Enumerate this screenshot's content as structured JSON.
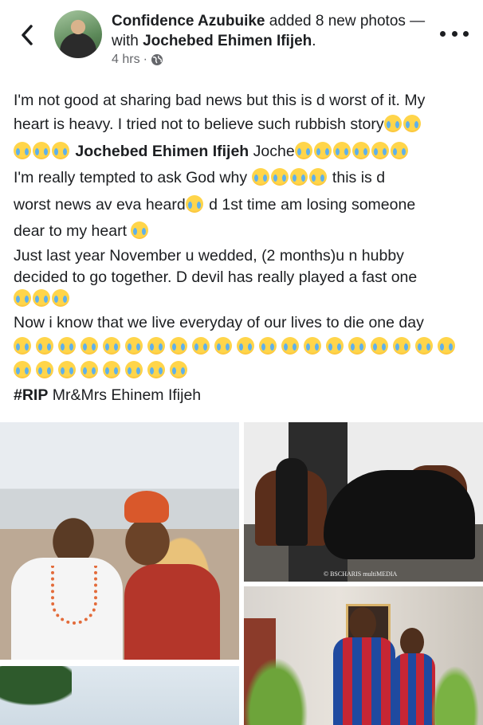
{
  "header": {
    "author": "Confidence Azubuike",
    "action": " added 8 new photos — with ",
    "tagged": "Jochebed Ehimen Ifijeh",
    "period": ".",
    "time": "4 hrs",
    "separator": "·"
  },
  "post": {
    "line1": "I'm not good at sharing bad news but this is d worst of it. My",
    "line2": "heart is heavy. I tried not to believe such rubbish story",
    "line3_mention": "Jochebed Ehimen Ifijeh",
    "line3_rest": " Joche",
    "line4a": "I'm really tempted to ask God why ",
    "line4b": " this is d",
    "line5a": "worst news av eva heard",
    "line5b": " d 1st time am losing someone",
    "line6": "dear to my heart ",
    "line7": "Just last year November u wedded, (2 months)u n hubby",
    "line8": "decided to go together.  D devil has really played a fast one",
    "line10": "Now i know that we live everyday of our lives to die one day",
    "hashtag": "#RIP",
    "line_last": " Mr&Mrs Ehinem Ifijeh"
  },
  "photos": {
    "watermark": "© BSCHARIS multiMEDIA"
  },
  "icons": {
    "back": "chevron-left-icon",
    "globe": "globe-icon",
    "more": "more-horizontal-icon",
    "emoji": "loudly-crying-face-emoji"
  },
  "colors": {
    "text": "#1c1e21",
    "meta": "#65676b"
  }
}
